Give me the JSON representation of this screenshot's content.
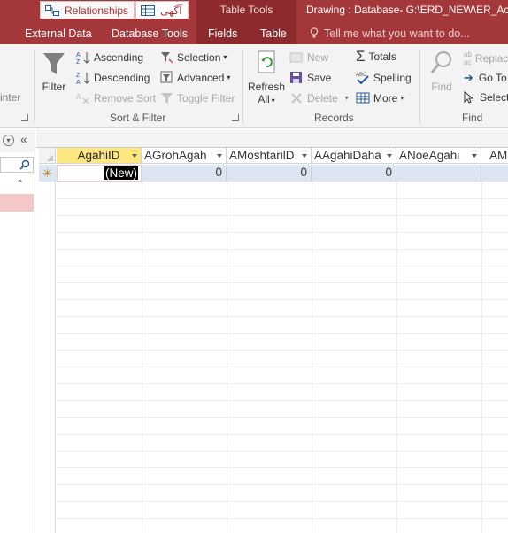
{
  "window": {
    "context_tab_label": "Table Tools",
    "title": "Drawing : Database- G:\\ERD_NEW\\ER_Acces"
  },
  "ribbon_tabs": [
    "External Data",
    "Database Tools",
    "Fields",
    "Table"
  ],
  "tell_me": "Tell me what you want to do...",
  "ribbon": {
    "clipboard": {
      "format_painter_fragment": "inter"
    },
    "sort_filter": {
      "filter": "Filter",
      "ascending": "Ascending",
      "descending": "Descending",
      "remove_sort": "Remove Sort",
      "selection": "Selection",
      "advanced": "Advanced",
      "toggle_filter": "Toggle Filter",
      "group_label": "Sort & Filter"
    },
    "records": {
      "refresh_line1": "Refresh",
      "refresh_line2": "All",
      "new": "New",
      "save": "Save",
      "delete": "Delete",
      "totals": "Totals",
      "spelling": "Spelling",
      "more": "More",
      "group_label": "Records"
    },
    "find": {
      "find": "Find",
      "replace": "Replac",
      "goto": "Go To",
      "select": "Select",
      "group_label": "Find"
    }
  },
  "document_tabs": [
    {
      "label": "Relationships",
      "icon": "relationships-icon"
    },
    {
      "label": "آگهی",
      "icon": "table-icon"
    }
  ],
  "datasheet": {
    "columns": [
      "AgahiID",
      "AGrohAgah",
      "AMoshtarilD",
      "AAgahiDaha",
      "ANoeAgahi",
      "AM"
    ],
    "new_row_marker": "✳",
    "new_row": [
      "(New)",
      "0",
      "0",
      "0",
      "",
      ""
    ]
  },
  "colors": {
    "ribbon_bar": "#a4373a",
    "context_band": "#8c2a2d",
    "selected_header": "#ffe780",
    "new_row": "#dde6f0",
    "nav_highlight": "#f4c7c9"
  }
}
